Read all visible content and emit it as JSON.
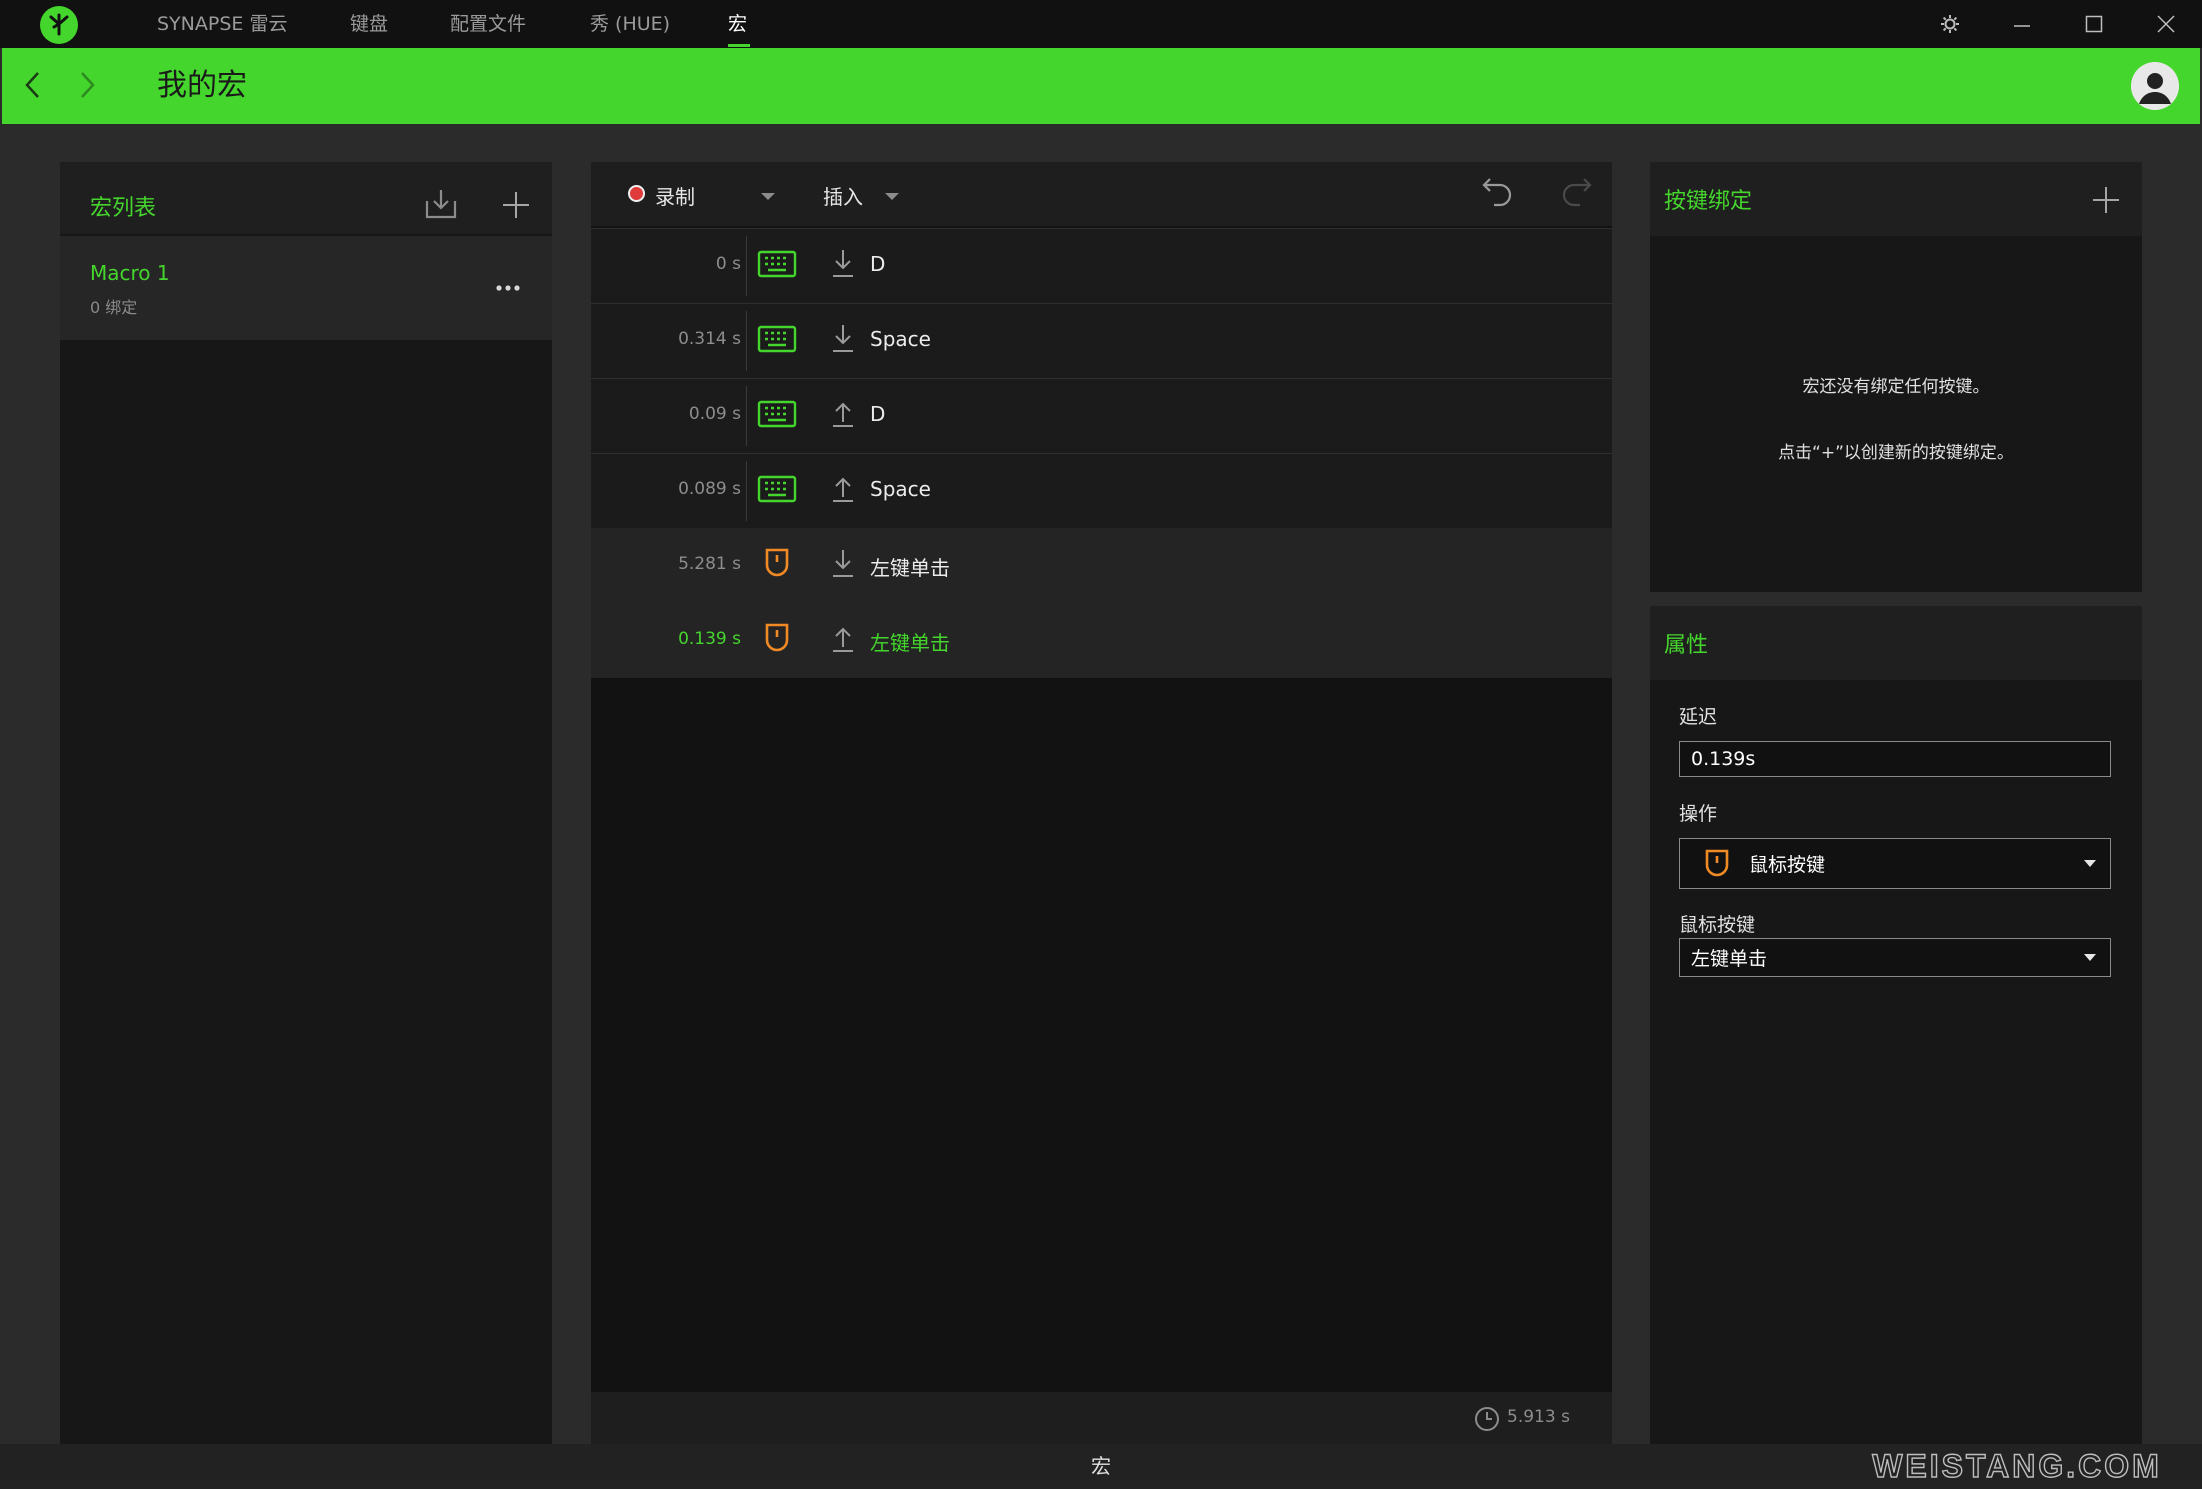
{
  "titlebar": {
    "tabs": [
      "SYNAPSE 雷云",
      "键盘",
      "配置文件",
      "秀 (HUE)",
      "宏"
    ],
    "active_tab": "宏"
  },
  "header": {
    "title": "我的宏"
  },
  "macro_list": {
    "title": "宏列表",
    "items": [
      {
        "name": "Macro 1",
        "bindings": "0 绑定"
      }
    ]
  },
  "editor": {
    "record_label": "录制",
    "insert_label": "插入",
    "rows": [
      {
        "delay": "0 s",
        "device": "keyboard-icon",
        "direction": "down",
        "key": "D"
      },
      {
        "delay": "0.314 s",
        "device": "keyboard-icon",
        "direction": "down",
        "key": "Space"
      },
      {
        "delay": "0.09 s",
        "device": "keyboard-icon",
        "direction": "up",
        "key": "D"
      },
      {
        "delay": "0.089 s",
        "device": "keyboard-icon",
        "direction": "up",
        "key": "Space"
      },
      {
        "delay": "5.281 s",
        "device": "mouse-icon",
        "direction": "down",
        "key": "左键单击"
      },
      {
        "delay": "0.139 s",
        "device": "mouse-icon",
        "direction": "up",
        "key": "左键单击",
        "selected": true
      }
    ],
    "total_time": "5.913 s"
  },
  "key_binding": {
    "title": "按键绑定",
    "empty_line1": "宏还没有绑定任何按键。",
    "empty_line2": "点击“+”以创建新的按键绑定。"
  },
  "properties": {
    "title": "属性",
    "delay_label": "延迟",
    "delay_value": "0.139s",
    "operation_label": "操作",
    "operation_value": "鼠标按键",
    "mouse_button_label": "鼠标按键",
    "mouse_button_value": "左键单击"
  },
  "statusbar": {
    "label": "宏"
  },
  "watermark": "WEISTANG.COM",
  "colors": {
    "accent": "#44d62c",
    "mouse": "#f08a24",
    "record": "#e03b3b",
    "background": "#2b2b2b"
  }
}
